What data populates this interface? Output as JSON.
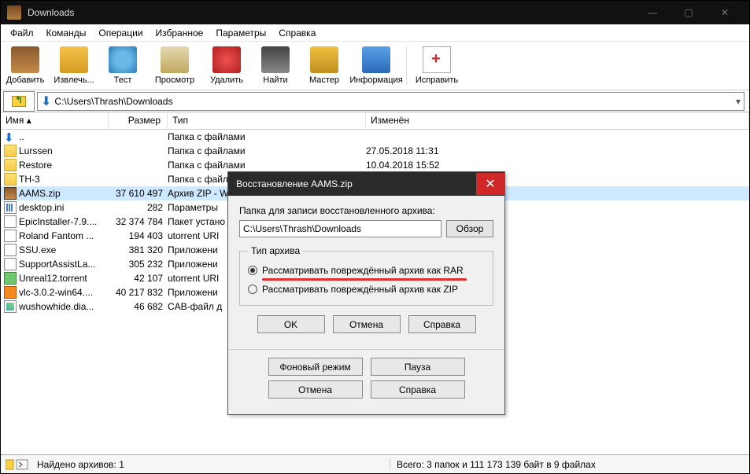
{
  "window": {
    "title": "Downloads"
  },
  "menu": [
    "Файл",
    "Команды",
    "Операции",
    "Избранное",
    "Параметры",
    "Справка"
  ],
  "toolbar": [
    {
      "id": "add",
      "label": "Добавить"
    },
    {
      "id": "extract",
      "label": "Извлечь..."
    },
    {
      "id": "test",
      "label": "Тест"
    },
    {
      "id": "view",
      "label": "Просмотр"
    },
    {
      "id": "delete",
      "label": "Удалить"
    },
    {
      "id": "find",
      "label": "Найти"
    },
    {
      "id": "wizard",
      "label": "Мастер"
    },
    {
      "id": "info",
      "label": "Информация"
    },
    {
      "id": "repair",
      "label": "Исправить"
    }
  ],
  "path": "C:\\Users\\Thrash\\Downloads",
  "columns": {
    "name": "Имя",
    "size": "Размер",
    "type": "Тип",
    "modified": "Изменён"
  },
  "rows": [
    {
      "icon": "up",
      "name": "..",
      "size": "",
      "type": "Папка с файлами",
      "mod": ""
    },
    {
      "icon": "folder",
      "name": "Lurssen",
      "size": "",
      "type": "Папка с файлами",
      "mod": "27.05.2018 11:31"
    },
    {
      "icon": "folder",
      "name": "Restore",
      "size": "",
      "type": "Папка с файлами",
      "mod": "10.04.2018 15:52"
    },
    {
      "icon": "folder",
      "name": "TH-3",
      "size": "",
      "type": "Папка с файлами",
      "mod": ""
    },
    {
      "icon": "zip",
      "name": "AAMS.zip",
      "size": "37 610 497",
      "type": "Архив ZIP - WinRAR",
      "mod": "",
      "selected": true
    },
    {
      "icon": "ini",
      "name": "desktop.ini",
      "size": "282",
      "type": "Параметры",
      "mod": ""
    },
    {
      "icon": "exe",
      "name": "EpicInstaller-7.9....",
      "size": "32 374 784",
      "type": "Пакет устано",
      "mod": ""
    },
    {
      "icon": "generic",
      "name": "Roland Fantom ...",
      "size": "194 403",
      "type": "utorrent URI",
      "mod": ""
    },
    {
      "icon": "exe",
      "name": "SSU.exe",
      "size": "381 320",
      "type": "Приложени",
      "mod": ""
    },
    {
      "icon": "exe",
      "name": "SupportAssistLa...",
      "size": "305 232",
      "type": "Приложени",
      "mod": ""
    },
    {
      "icon": "torrent",
      "name": "Unreal12.torrent",
      "size": "42 107",
      "type": "utorrent URI",
      "mod": ""
    },
    {
      "icon": "vlc",
      "name": "vlc-3.0.2-win64....",
      "size": "40 217 832",
      "type": "Приложени",
      "mod": ""
    },
    {
      "icon": "diag",
      "name": "wushowhide.dia...",
      "size": "46 682",
      "type": "CAB-файл д",
      "mod": ""
    }
  ],
  "status": {
    "left": "Найдено архивов: 1",
    "right": "Всего: 3 папок и 111 173 139 байт в 9 файлах"
  },
  "dialog": {
    "title": "Восстановление AAMS.zip",
    "pathLabel": "Папка для записи восстановленного архива:",
    "path": "C:\\Users\\Thrash\\Downloads",
    "browse": "Обзор",
    "groupTitle": "Тип архива",
    "radio1": "Рассматривать повреждённый архив как RAR",
    "radio2": "Рассматривать повреждённый архив как ZIP",
    "ok": "OK",
    "cancel": "Отмена",
    "help": "Справка",
    "bg": "Фоновый режим",
    "pause": "Пауза",
    "cancel2": "Отмена",
    "help2": "Справка"
  }
}
